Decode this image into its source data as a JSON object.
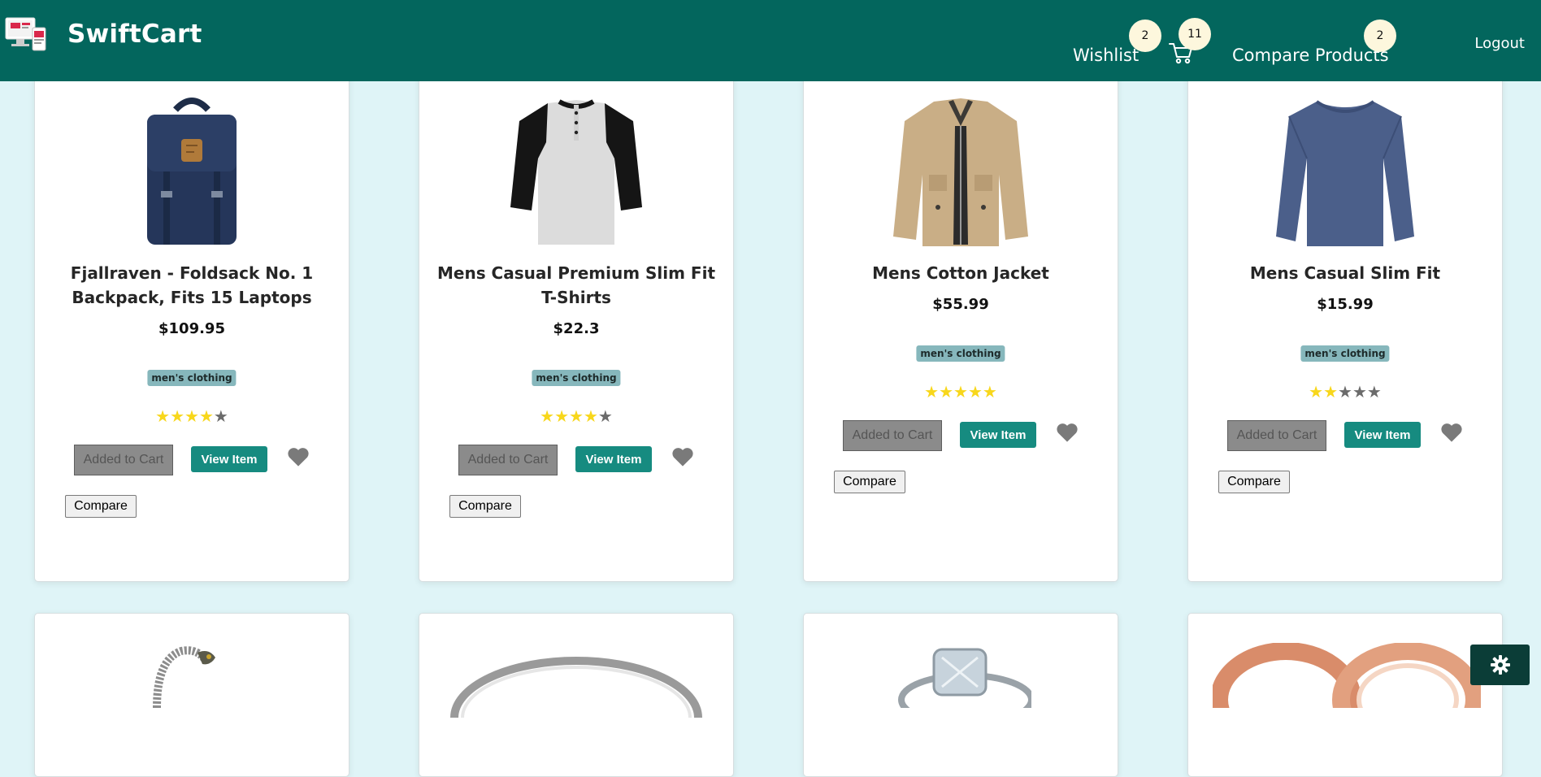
{
  "navbar": {
    "brand": "SwiftCart",
    "wishlist_label": "Wishlist",
    "wishlist_count": "2",
    "cart_count": "11",
    "compare_label": "Compare Products",
    "compare_count": "2",
    "logout_label": "Logout"
  },
  "colors": {
    "navbar": "#03665d",
    "page_bg": "#dff4f7",
    "view_button": "#168b80",
    "category_badge": "#86b7bc",
    "star_on": "#f8d71b",
    "star_off": "#6b6b6b",
    "badge_bg": "#fdf7dd"
  },
  "products": [
    {
      "title": "Fjallraven - Foldsack No. 1 Backpack, Fits 15 Laptops",
      "price": "$109.95",
      "category": "men's clothing",
      "rating_stars": 4,
      "image_icon": "backpack-image",
      "added_label": "Added to Cart",
      "view_label": "View Item",
      "compare_label": "Compare"
    },
    {
      "title": "Mens Casual Premium Slim Fit T-Shirts",
      "price": "$22.3",
      "category": "men's clothing",
      "rating_stars": 4,
      "image_icon": "raglan-shirt-image",
      "added_label": "Added to Cart",
      "view_label": "View Item",
      "compare_label": "Compare"
    },
    {
      "title": "Mens Cotton Jacket",
      "price": "$55.99",
      "category": "men's clothing",
      "rating_stars": 5,
      "image_icon": "jacket-image",
      "added_label": "Added to Cart",
      "view_label": "View Item",
      "compare_label": "Compare"
    },
    {
      "title": "Mens Casual Slim Fit",
      "price": "$15.99",
      "category": "men's clothing",
      "rating_stars": 2,
      "image_icon": "long-sleeve-shirt-image",
      "added_label": "Added to Cart",
      "view_label": "View Item",
      "compare_label": "Compare"
    }
  ],
  "row2_images": [
    "bracelet-image",
    "silver-ring-image",
    "diamond-ring-image",
    "rose-gold-rings-image"
  ],
  "settings_icon": "gear-icon"
}
